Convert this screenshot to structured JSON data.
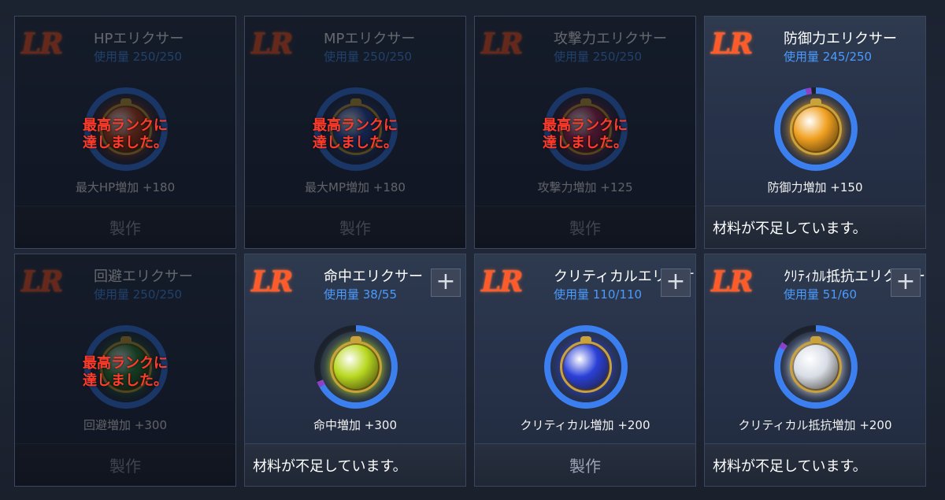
{
  "colors": {
    "accent_blue": "#4a9bff",
    "lr_orange": "#ff5a2a",
    "max_red": "#ff3b2a",
    "ring_track": "#1c222d",
    "ring_blue": "#3b7ff0",
    "ring_purple": "#8e3fc8"
  },
  "cards": [
    {
      "rarity": "LR",
      "title": "HPエリクサー",
      "usage": "使用量 250/250",
      "state": "maxed",
      "max_message": "最高ランクに\n達しました。",
      "effect": "最大HP増加 +180",
      "craft_label": "製作",
      "gem_color": "#c8461e",
      "gem_icon": "elixir-hp-icon",
      "progress": 1.0,
      "has_plus": false
    },
    {
      "rarity": "LR",
      "title": "MPエリクサー",
      "usage": "使用量 250/250",
      "state": "maxed",
      "max_message": "最高ランクに\n達しました。",
      "effect": "最大MP増加 +180",
      "craft_label": "製作",
      "gem_color": "#2a4fb0",
      "gem_icon": "elixir-mp-icon",
      "progress": 1.0,
      "has_plus": false
    },
    {
      "rarity": "LR",
      "title": "攻撃力エリクサー",
      "usage": "使用量 250/250",
      "state": "maxed",
      "max_message": "最高ランクに\n達しました。",
      "effect": "攻撃力増加 +125",
      "craft_label": "製作",
      "gem_color": "#b02a5a",
      "gem_icon": "elixir-attack-icon",
      "progress": 1.0,
      "has_plus": false
    },
    {
      "rarity": "LR",
      "title": "防御力エリクサー",
      "usage": "使用量 245/250",
      "state": "insufficient",
      "max_message": "",
      "effect": "防御力増加 +150",
      "shortage_label": "材料が不足しています。",
      "gem_color": "#f0a020",
      "gem_icon": "elixir-defense-icon",
      "progress": 0.98,
      "has_plus": false
    },
    {
      "rarity": "LR",
      "title": "回避エリクサー",
      "usage": "使用量 250/250",
      "state": "maxed",
      "max_message": "最高ランクに\n達しました。",
      "effect": "回避増加 +300",
      "craft_label": "製作",
      "gem_color": "#2e8a3a",
      "gem_icon": "elixir-evasion-icon",
      "progress": 1.0,
      "has_plus": false
    },
    {
      "rarity": "LR",
      "title": "命中エリクサー",
      "usage": "使用量 38/55",
      "state": "insufficient",
      "max_message": "",
      "effect": "命中増加 +300",
      "shortage_label": "材料が不足しています。",
      "gem_color": "#b8d820",
      "gem_icon": "elixir-accuracy-icon",
      "progress": 0.69,
      "has_plus": true
    },
    {
      "rarity": "LR",
      "title": "クリティカルエリクサー",
      "usage": "使用量 110/110",
      "state": "craftable",
      "max_message": "",
      "effect": "クリティカル増加 +200",
      "craft_label": "製作",
      "gem_color": "#2a40d8",
      "gem_icon": "elixir-critical-icon",
      "progress": 1.0,
      "has_plus": true
    },
    {
      "rarity": "LR",
      "title": "ｸﾘﾃｨｶﾙ抵抗エリクサー",
      "usage": "使用量 51/60",
      "state": "insufficient",
      "max_message": "",
      "effect": "クリティカル抵抗増加 +200",
      "shortage_label": "材料が不足しています。",
      "gem_color": "#d8dde6",
      "gem_icon": "elixir-crit-resist-icon",
      "progress": 0.85,
      "has_plus": true
    }
  ]
}
